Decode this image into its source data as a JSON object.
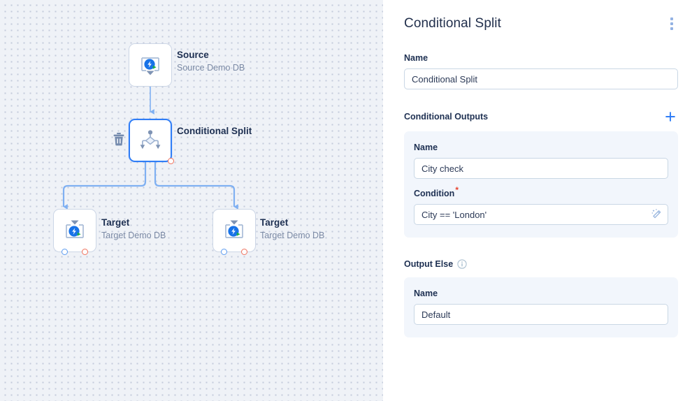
{
  "canvas": {
    "nodes": [
      {
        "id": "source",
        "icon": "database-source-icon",
        "title": "Source",
        "subtitle": "Source Demo DB"
      },
      {
        "id": "conditional-split",
        "icon": "split-branch-icon",
        "title": "Conditional Split",
        "subtitle": ""
      },
      {
        "id": "target-left",
        "icon": "database-target-icon",
        "title": "Target",
        "subtitle": "Target Demo DB"
      },
      {
        "id": "target-right",
        "icon": "database-target-icon",
        "title": "Target",
        "subtitle": "Target Demo DB"
      }
    ],
    "delete_icon": "trash-icon",
    "colors": {
      "background": "#eff2f7",
      "dot_grid": "#c3cbdb",
      "edge": "#7fb0f2",
      "selected_border": "#2f7df6",
      "port_blue": "#5b9bf0",
      "port_red": "#f0715c"
    }
  },
  "panel": {
    "title": "Conditional Split",
    "menu_icon": "kebab-menu-icon",
    "name_field": {
      "label": "Name",
      "value": "Conditional Split",
      "placeholder": "Name"
    },
    "conditional_outputs": {
      "title": "Conditional Outputs",
      "add_icon": "plus-icon",
      "items": [
        {
          "name_label": "Name",
          "name_value": "City check",
          "name_placeholder": "Name",
          "condition_label": "Condition",
          "condition_required": "*",
          "condition_value": "City == 'London'",
          "condition_placeholder": "Condition",
          "condition_icon": "magic-wand-icon"
        }
      ]
    },
    "output_else": {
      "title": "Output Else",
      "info_icon": "info-icon",
      "name_label": "Name",
      "name_value": "Default",
      "name_placeholder": "Name"
    },
    "colors": {
      "accent": "#2f7df6",
      "card_bg": "#f2f6fc",
      "label": "#1e3052",
      "required": "#e8442f"
    }
  }
}
